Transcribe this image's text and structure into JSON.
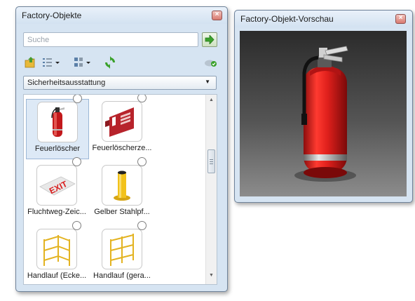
{
  "objects_window": {
    "title": "Factory-Objekte",
    "close_icon": "close-icon",
    "search": {
      "placeholder": "Suche"
    },
    "toolbar_icons": [
      "folder-import-icon",
      "list-view-icon",
      "thumbnail-view-icon",
      "refresh-icon",
      "cloud-sync-icon"
    ],
    "category": "Sicherheitsausstattung",
    "items": [
      {
        "label": "Feuerlöscher",
        "icon": "fire-extinguisher-icon",
        "selected": true
      },
      {
        "label": "Feuerlöscherze...",
        "icon": "fire-extinguisher-sign-icon",
        "selected": false
      },
      {
        "label": "Fluchtweg-Zeic...",
        "icon": "exit-sign-icon",
        "selected": false
      },
      {
        "label": "Gelber Stahlpf...",
        "icon": "yellow-steel-post-icon",
        "selected": false
      },
      {
        "label": "Handlauf (Ecke...",
        "icon": "corner-handrail-icon",
        "selected": false
      },
      {
        "label": "Handlauf (gera...",
        "icon": "straight-handrail-icon",
        "selected": false
      }
    ]
  },
  "preview_window": {
    "title": "Factory-Objekt-Vorschau",
    "preview_icon": "fire-extinguisher-3d-icon"
  },
  "colors": {
    "window_frame": "#d6e4f2",
    "selection": "#dde9f6",
    "extinguisher_red": "#e0201c",
    "post_yellow": "#f2c21b"
  }
}
